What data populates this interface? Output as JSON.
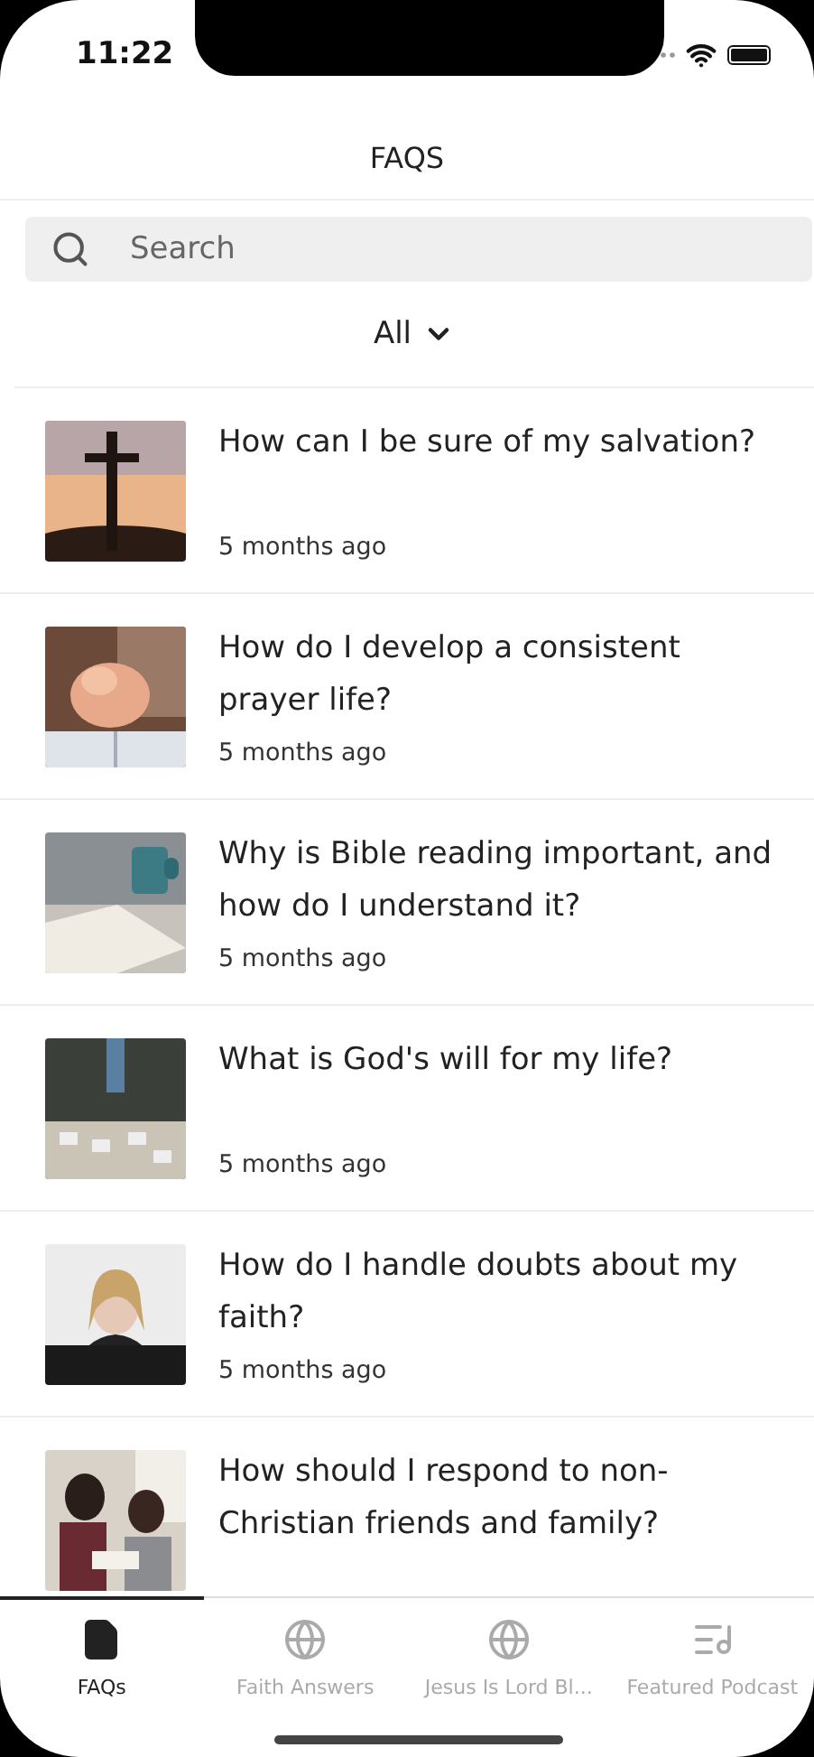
{
  "status_bar": {
    "time": "11:22"
  },
  "header": {
    "title": "FAQS"
  },
  "search": {
    "placeholder": "Search"
  },
  "filter": {
    "label": "All"
  },
  "faqs": [
    {
      "question": "How can I be sure of my salvation?",
      "time": "5 months ago"
    },
    {
      "question": "How do I develop a consistent prayer life?",
      "time": "5 months ago"
    },
    {
      "question": "Why is Bible reading important, and how do I understand it?",
      "time": "5 months ago"
    },
    {
      "question": "What is God's will for my life?",
      "time": "5 months ago"
    },
    {
      "question": "How do I handle doubts about my faith?",
      "time": "5 months ago"
    },
    {
      "question": "How should I respond to non-Christian friends and family?"
    }
  ],
  "tabs": [
    {
      "label": "FAQs",
      "kind": "document",
      "selected": true
    },
    {
      "label": "Faith Answers",
      "kind": "globe",
      "selected": false
    },
    {
      "label": "Jesus Is Lord Bl...",
      "kind": "globe",
      "selected": false
    },
    {
      "label": "Featured Podcast",
      "kind": "music",
      "selected": false
    }
  ]
}
